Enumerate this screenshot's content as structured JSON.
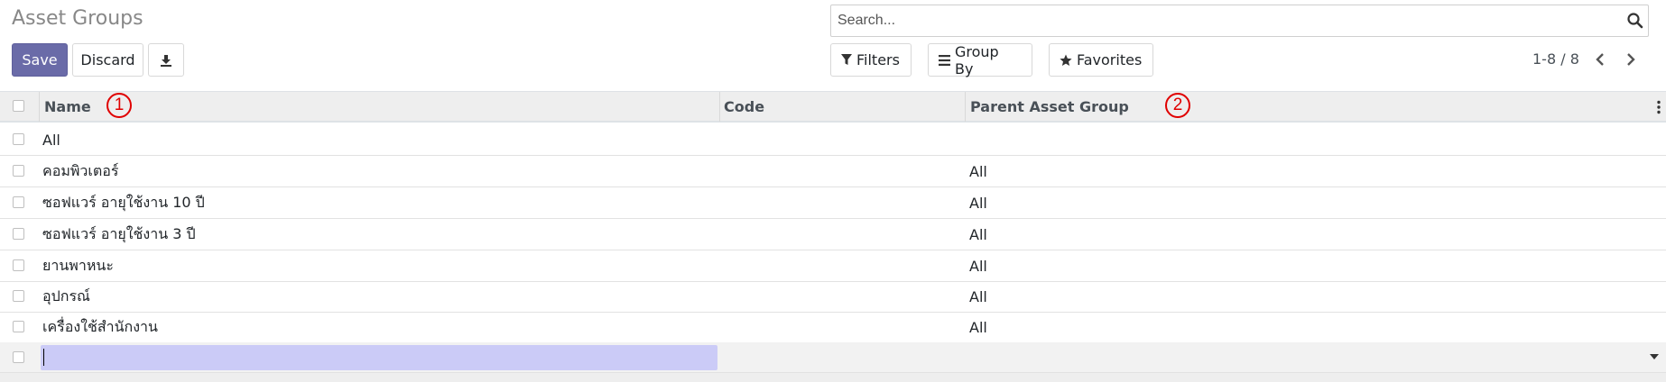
{
  "header": {
    "title": "Asset Groups",
    "save_label": "Save",
    "discard_label": "Discard"
  },
  "search": {
    "placeholder": "Search..."
  },
  "filters": {
    "filters_label": "Filters",
    "group_by_label": "Group By",
    "favorites_label": "Favorites"
  },
  "pager": {
    "text": "1-8 / 8"
  },
  "table": {
    "columns": [
      "Name",
      "Code",
      "Parent Asset Group"
    ],
    "rows": [
      {
        "name": "All",
        "code": "",
        "parent": ""
      },
      {
        "name": "คอมพิวเตอร์",
        "code": "",
        "parent": "All"
      },
      {
        "name": "ซอฟแวร์ อายุใช้งาน 10 ปี",
        "code": "",
        "parent": "All"
      },
      {
        "name": "ซอฟแวร์ อายุใช้งาน 3 ปี",
        "code": "",
        "parent": "All"
      },
      {
        "name": "ยานพาหนะ",
        "code": "",
        "parent": "All"
      },
      {
        "name": "อุปกรณ์",
        "code": "",
        "parent": "All"
      },
      {
        "name": "เครื่องใช้สำนักงาน",
        "code": "",
        "parent": "All"
      }
    ]
  },
  "markers": [
    "1",
    "2"
  ],
  "colors": {
    "primary": "#6a6ba8",
    "header_bg": "#eeeeee",
    "edit_highlight": "#cbcbf7",
    "marker": "#e00000"
  }
}
